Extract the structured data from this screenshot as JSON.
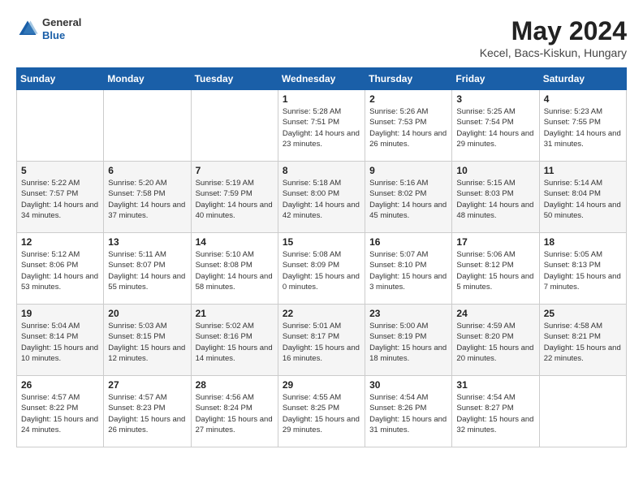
{
  "header": {
    "logo": {
      "general": "General",
      "blue": "Blue"
    },
    "title": "May 2024",
    "location": "Kecel, Bacs-Kiskun, Hungary"
  },
  "calendar": {
    "days_of_week": [
      "Sunday",
      "Monday",
      "Tuesday",
      "Wednesday",
      "Thursday",
      "Friday",
      "Saturday"
    ],
    "weeks": [
      [
        {
          "day": null
        },
        {
          "day": null
        },
        {
          "day": null
        },
        {
          "day": 1,
          "sunrise": "5:28 AM",
          "sunset": "7:51 PM",
          "daylight": "14 hours and 23 minutes."
        },
        {
          "day": 2,
          "sunrise": "5:26 AM",
          "sunset": "7:53 PM",
          "daylight": "14 hours and 26 minutes."
        },
        {
          "day": 3,
          "sunrise": "5:25 AM",
          "sunset": "7:54 PM",
          "daylight": "14 hours and 29 minutes."
        },
        {
          "day": 4,
          "sunrise": "5:23 AM",
          "sunset": "7:55 PM",
          "daylight": "14 hours and 31 minutes."
        }
      ],
      [
        {
          "day": 5,
          "sunrise": "5:22 AM",
          "sunset": "7:57 PM",
          "daylight": "14 hours and 34 minutes."
        },
        {
          "day": 6,
          "sunrise": "5:20 AM",
          "sunset": "7:58 PM",
          "daylight": "14 hours and 37 minutes."
        },
        {
          "day": 7,
          "sunrise": "5:19 AM",
          "sunset": "7:59 PM",
          "daylight": "14 hours and 40 minutes."
        },
        {
          "day": 8,
          "sunrise": "5:18 AM",
          "sunset": "8:00 PM",
          "daylight": "14 hours and 42 minutes."
        },
        {
          "day": 9,
          "sunrise": "5:16 AM",
          "sunset": "8:02 PM",
          "daylight": "14 hours and 45 minutes."
        },
        {
          "day": 10,
          "sunrise": "5:15 AM",
          "sunset": "8:03 PM",
          "daylight": "14 hours and 48 minutes."
        },
        {
          "day": 11,
          "sunrise": "5:14 AM",
          "sunset": "8:04 PM",
          "daylight": "14 hours and 50 minutes."
        }
      ],
      [
        {
          "day": 12,
          "sunrise": "5:12 AM",
          "sunset": "8:06 PM",
          "daylight": "14 hours and 53 minutes."
        },
        {
          "day": 13,
          "sunrise": "5:11 AM",
          "sunset": "8:07 PM",
          "daylight": "14 hours and 55 minutes."
        },
        {
          "day": 14,
          "sunrise": "5:10 AM",
          "sunset": "8:08 PM",
          "daylight": "14 hours and 58 minutes."
        },
        {
          "day": 15,
          "sunrise": "5:08 AM",
          "sunset": "8:09 PM",
          "daylight": "15 hours and 0 minutes."
        },
        {
          "day": 16,
          "sunrise": "5:07 AM",
          "sunset": "8:10 PM",
          "daylight": "15 hours and 3 minutes."
        },
        {
          "day": 17,
          "sunrise": "5:06 AM",
          "sunset": "8:12 PM",
          "daylight": "15 hours and 5 minutes."
        },
        {
          "day": 18,
          "sunrise": "5:05 AM",
          "sunset": "8:13 PM",
          "daylight": "15 hours and 7 minutes."
        }
      ],
      [
        {
          "day": 19,
          "sunrise": "5:04 AM",
          "sunset": "8:14 PM",
          "daylight": "15 hours and 10 minutes."
        },
        {
          "day": 20,
          "sunrise": "5:03 AM",
          "sunset": "8:15 PM",
          "daylight": "15 hours and 12 minutes."
        },
        {
          "day": 21,
          "sunrise": "5:02 AM",
          "sunset": "8:16 PM",
          "daylight": "15 hours and 14 minutes."
        },
        {
          "day": 22,
          "sunrise": "5:01 AM",
          "sunset": "8:17 PM",
          "daylight": "15 hours and 16 minutes."
        },
        {
          "day": 23,
          "sunrise": "5:00 AM",
          "sunset": "8:19 PM",
          "daylight": "15 hours and 18 minutes."
        },
        {
          "day": 24,
          "sunrise": "4:59 AM",
          "sunset": "8:20 PM",
          "daylight": "15 hours and 20 minutes."
        },
        {
          "day": 25,
          "sunrise": "4:58 AM",
          "sunset": "8:21 PM",
          "daylight": "15 hours and 22 minutes."
        }
      ],
      [
        {
          "day": 26,
          "sunrise": "4:57 AM",
          "sunset": "8:22 PM",
          "daylight": "15 hours and 24 minutes."
        },
        {
          "day": 27,
          "sunrise": "4:57 AM",
          "sunset": "8:23 PM",
          "daylight": "15 hours and 26 minutes."
        },
        {
          "day": 28,
          "sunrise": "4:56 AM",
          "sunset": "8:24 PM",
          "daylight": "15 hours and 27 minutes."
        },
        {
          "day": 29,
          "sunrise": "4:55 AM",
          "sunset": "8:25 PM",
          "daylight": "15 hours and 29 minutes."
        },
        {
          "day": 30,
          "sunrise": "4:54 AM",
          "sunset": "8:26 PM",
          "daylight": "15 hours and 31 minutes."
        },
        {
          "day": 31,
          "sunrise": "4:54 AM",
          "sunset": "8:27 PM",
          "daylight": "15 hours and 32 minutes."
        },
        {
          "day": null
        }
      ]
    ]
  }
}
